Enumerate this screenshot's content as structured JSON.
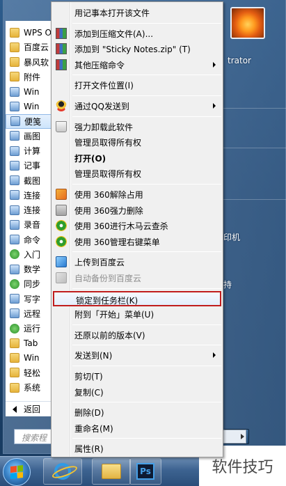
{
  "start_menu": {
    "programs": [
      {
        "label": "WPS O",
        "icon": "folder-icon"
      },
      {
        "label": "百度云",
        "icon": "folder-icon"
      },
      {
        "label": "暴风软",
        "icon": "folder-icon"
      },
      {
        "label": "附件",
        "icon": "folder-icon"
      },
      {
        "label": "Win",
        "icon": "app-icon"
      },
      {
        "label": "Win",
        "icon": "app-icon"
      },
      {
        "label": "便笺",
        "icon": "sticky-notes-icon"
      },
      {
        "label": "画图",
        "icon": "paint-icon"
      },
      {
        "label": "计算",
        "icon": "calculator-icon"
      },
      {
        "label": "记事",
        "icon": "notepad-icon"
      },
      {
        "label": "截图",
        "icon": "snipping-icon"
      },
      {
        "label": "连接",
        "icon": "projector-icon"
      },
      {
        "label": "连接",
        "icon": "remote-desktop-icon"
      },
      {
        "label": "录音",
        "icon": "microphone-icon"
      },
      {
        "label": "命令",
        "icon": "cmd-icon"
      },
      {
        "label": "入门",
        "icon": "getting-started-icon"
      },
      {
        "label": "数学",
        "icon": "math-icon"
      },
      {
        "label": "同步",
        "icon": "sync-icon"
      },
      {
        "label": "写字",
        "icon": "wordpad-icon"
      },
      {
        "label": "远程",
        "icon": "remote-icon"
      },
      {
        "label": "运行",
        "icon": "run-icon"
      },
      {
        "label": "Tab",
        "icon": "folder-icon"
      },
      {
        "label": "Win",
        "icon": "folder-icon"
      },
      {
        "label": "轻松",
        "icon": "folder-icon"
      },
      {
        "label": "系统",
        "icon": "folder-icon"
      }
    ],
    "selected_index": 6,
    "back_label": "返回",
    "search_placeholder": "搜索程",
    "right": {
      "user_text": "trator",
      "printer_text": "印机",
      "help_text": "持"
    }
  },
  "context_menu": {
    "items": [
      {
        "type": "item",
        "label": "用记事本打开该文件",
        "icon": "",
        "submenu": false,
        "bold": false,
        "disabled": false,
        "highlight": false
      },
      {
        "type": "sep"
      },
      {
        "type": "item",
        "label": "添加到压缩文件(A)...",
        "icon": "zip",
        "submenu": false,
        "bold": false,
        "disabled": false,
        "highlight": false
      },
      {
        "type": "item",
        "label": "添加到 \"Sticky Notes.zip\" (T)",
        "icon": "zip",
        "submenu": false,
        "bold": false,
        "disabled": false,
        "highlight": false
      },
      {
        "type": "item",
        "label": "其他压缩命令",
        "icon": "zip",
        "submenu": true,
        "bold": false,
        "disabled": false,
        "highlight": false
      },
      {
        "type": "sep"
      },
      {
        "type": "item",
        "label": "打开文件位置(I)",
        "icon": "",
        "submenu": false,
        "bold": false,
        "disabled": false,
        "highlight": false
      },
      {
        "type": "sep"
      },
      {
        "type": "item",
        "label": "通过QQ发送到",
        "icon": "qq",
        "submenu": true,
        "bold": false,
        "disabled": false,
        "highlight": false
      },
      {
        "type": "sep"
      },
      {
        "type": "item",
        "label": "强力卸载此软件",
        "icon": "trash",
        "submenu": false,
        "bold": false,
        "disabled": false,
        "highlight": false
      },
      {
        "type": "item",
        "label": "管理员取得所有权",
        "icon": "",
        "submenu": false,
        "bold": false,
        "disabled": false,
        "highlight": false
      },
      {
        "type": "item",
        "label": "打开(O)",
        "icon": "",
        "submenu": false,
        "bold": true,
        "disabled": false,
        "highlight": false
      },
      {
        "type": "item",
        "label": "管理员取得所有权",
        "icon": "",
        "submenu": false,
        "bold": false,
        "disabled": false,
        "highlight": false
      },
      {
        "type": "sep"
      },
      {
        "type": "item",
        "label": "使用 360解除占用",
        "icon": "360a",
        "submenu": false,
        "bold": false,
        "disabled": false,
        "highlight": false
      },
      {
        "type": "item",
        "label": "使用 360强力删除",
        "icon": "360b",
        "submenu": false,
        "bold": false,
        "disabled": false,
        "highlight": false
      },
      {
        "type": "item",
        "label": "使用 360进行木马云查杀",
        "icon": "360c",
        "submenu": false,
        "bold": false,
        "disabled": false,
        "highlight": false
      },
      {
        "type": "item",
        "label": "使用 360管理右键菜单",
        "icon": "360c",
        "submenu": false,
        "bold": false,
        "disabled": false,
        "highlight": false
      },
      {
        "type": "sep"
      },
      {
        "type": "item",
        "label": "上传到百度云",
        "icon": "cloud",
        "submenu": false,
        "bold": false,
        "disabled": false,
        "highlight": false
      },
      {
        "type": "item",
        "label": "自动备份到百度云",
        "icon": "cloud-dis",
        "submenu": false,
        "bold": false,
        "disabled": true,
        "highlight": false
      },
      {
        "type": "sep"
      },
      {
        "type": "item",
        "label": "锁定到任务栏(K)",
        "icon": "",
        "submenu": false,
        "bold": false,
        "disabled": false,
        "highlight": true
      },
      {
        "type": "item",
        "label": "附到「开始」菜单(U)",
        "icon": "",
        "submenu": false,
        "bold": false,
        "disabled": false,
        "highlight": false
      },
      {
        "type": "sep"
      },
      {
        "type": "item",
        "label": "还原以前的版本(V)",
        "icon": "",
        "submenu": false,
        "bold": false,
        "disabled": false,
        "highlight": false
      },
      {
        "type": "sep"
      },
      {
        "type": "item",
        "label": "发送到(N)",
        "icon": "",
        "submenu": true,
        "bold": false,
        "disabled": false,
        "highlight": false
      },
      {
        "type": "sep"
      },
      {
        "type": "item",
        "label": "剪切(T)",
        "icon": "",
        "submenu": false,
        "bold": false,
        "disabled": false,
        "highlight": false
      },
      {
        "type": "item",
        "label": "复制(C)",
        "icon": "",
        "submenu": false,
        "bold": false,
        "disabled": false,
        "highlight": false
      },
      {
        "type": "sep"
      },
      {
        "type": "item",
        "label": "删除(D)",
        "icon": "",
        "submenu": false,
        "bold": false,
        "disabled": false,
        "highlight": false
      },
      {
        "type": "item",
        "label": "重命名(M)",
        "icon": "",
        "submenu": false,
        "bold": false,
        "disabled": false,
        "highlight": false
      },
      {
        "type": "sep"
      },
      {
        "type": "item",
        "label": "属性(R)",
        "icon": "",
        "submenu": false,
        "bold": false,
        "disabled": false,
        "highlight": false
      }
    ]
  },
  "taskbar": {
    "buttons": [
      {
        "name": "ie-icon"
      },
      {
        "name": "explorer-icon"
      },
      {
        "name": "photoshop-icon",
        "label": "Ps"
      }
    ]
  },
  "watermark": "软件技巧",
  "colors": {
    "highlight_border": "#c01d1d",
    "menu_bg": "#f0f0f0",
    "taskbar": "#3d6391"
  }
}
